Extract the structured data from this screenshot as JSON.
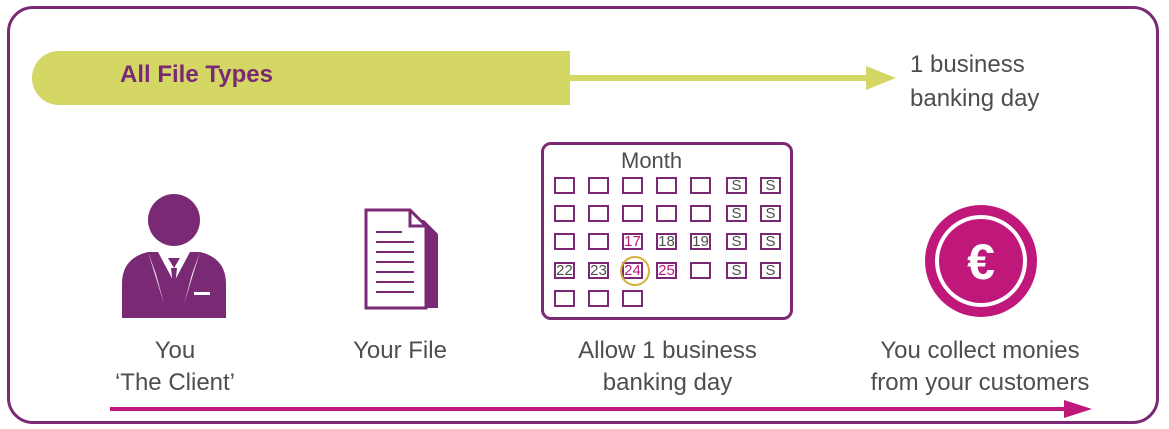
{
  "banner": {
    "title": "All File Types",
    "result": "1 business banking day"
  },
  "steps": {
    "client": {
      "line1": "You",
      "line2": "‘The Client’"
    },
    "file": {
      "label": "Your File"
    },
    "calendar": {
      "title": "Month",
      "line1": "Allow 1 business",
      "line2": "banking day"
    },
    "collect": {
      "line1": "You collect monies",
      "line2": "from your customers",
      "symbol": "€"
    }
  },
  "calendar_cells": [
    [
      "",
      "",
      "",
      "",
      "",
      "S",
      "S"
    ],
    [
      "",
      "",
      "",
      "",
      "",
      "S",
      "S"
    ],
    [
      "",
      "",
      "17",
      "18",
      "19",
      "S",
      "S"
    ],
    [
      "22",
      "23",
      "24",
      "25",
      "",
      "S",
      "S"
    ],
    [
      "",
      "",
      ""
    ]
  ],
  "colors": {
    "purple": "#7a2a74",
    "magenta": "#c0187a",
    "lime": "#d4d763",
    "highlight": "#d4b23a"
  },
  "icons": [
    "person-icon",
    "document-icon",
    "calendar-icon",
    "euro-coin-icon"
  ]
}
